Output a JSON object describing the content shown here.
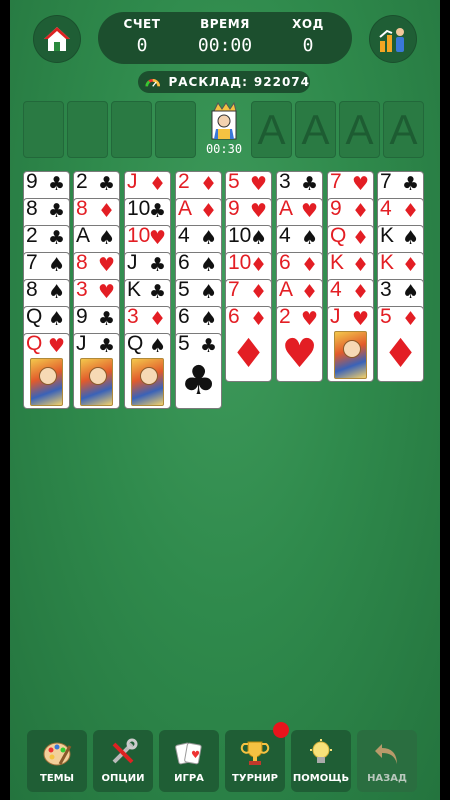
{
  "scoreboard": {
    "score_label": "СЧЕТ",
    "score_value": "0",
    "time_label": "ВРЕМЯ",
    "time_value": "00:00",
    "moves_label": "ХОД",
    "moves_value": "0"
  },
  "deal": {
    "label": "РАСКЛАД:",
    "number": "922074"
  },
  "top_row": {
    "free_cells": 4,
    "center_timer": "00:30",
    "foundations": [
      "A",
      "A",
      "A",
      "A"
    ]
  },
  "tableau": [
    [
      {
        "r": "9",
        "s": "♣",
        "c": "blk"
      },
      {
        "r": "8",
        "s": "♣",
        "c": "blk"
      },
      {
        "r": "2",
        "s": "♣",
        "c": "blk"
      },
      {
        "r": "7",
        "s": "♠",
        "c": "blk"
      },
      {
        "r": "8",
        "s": "♠",
        "c": "blk"
      },
      {
        "r": "Q",
        "s": "♠",
        "c": "blk"
      },
      {
        "r": "Q",
        "s": "♥",
        "c": "red",
        "face": true
      }
    ],
    [
      {
        "r": "2",
        "s": "♣",
        "c": "blk"
      },
      {
        "r": "8",
        "s": "♦",
        "c": "red"
      },
      {
        "r": "A",
        "s": "♠",
        "c": "blk"
      },
      {
        "r": "8",
        "s": "♥",
        "c": "red"
      },
      {
        "r": "3",
        "s": "♥",
        "c": "red"
      },
      {
        "r": "9",
        "s": "♣",
        "c": "blk"
      },
      {
        "r": "J",
        "s": "♣",
        "c": "blk",
        "face": true
      }
    ],
    [
      {
        "r": "J",
        "s": "♦",
        "c": "red"
      },
      {
        "r": "10",
        "s": "♣",
        "c": "blk"
      },
      {
        "r": "10",
        "s": "♥",
        "c": "red"
      },
      {
        "r": "J",
        "s": "♣",
        "c": "blk"
      },
      {
        "r": "K",
        "s": "♣",
        "c": "blk"
      },
      {
        "r": "3",
        "s": "♦",
        "c": "red"
      },
      {
        "r": "Q",
        "s": "♠",
        "c": "blk",
        "face": true
      }
    ],
    [
      {
        "r": "2",
        "s": "♦",
        "c": "red"
      },
      {
        "r": "A",
        "s": "♦",
        "c": "red"
      },
      {
        "r": "4",
        "s": "♠",
        "c": "blk"
      },
      {
        "r": "6",
        "s": "♠",
        "c": "blk"
      },
      {
        "r": "5",
        "s": "♠",
        "c": "blk"
      },
      {
        "r": "6",
        "s": "♠",
        "c": "blk"
      },
      {
        "r": "5",
        "s": "♣",
        "c": "blk",
        "big": true
      }
    ],
    [
      {
        "r": "5",
        "s": "♥",
        "c": "red"
      },
      {
        "r": "9",
        "s": "♥",
        "c": "red"
      },
      {
        "r": "10",
        "s": "♠",
        "c": "blk"
      },
      {
        "r": "10",
        "s": "♦",
        "c": "red"
      },
      {
        "r": "7",
        "s": "♦",
        "c": "red"
      },
      {
        "r": "6",
        "s": "♦",
        "c": "red",
        "big": true
      }
    ],
    [
      {
        "r": "3",
        "s": "♣",
        "c": "blk"
      },
      {
        "r": "A",
        "s": "♥",
        "c": "red"
      },
      {
        "r": "4",
        "s": "♠",
        "c": "blk"
      },
      {
        "r": "6",
        "s": "♦",
        "c": "red"
      },
      {
        "r": "A",
        "s": "♦",
        "c": "red"
      },
      {
        "r": "2",
        "s": "♥",
        "c": "red",
        "big": true
      }
    ],
    [
      {
        "r": "7",
        "s": "♥",
        "c": "red"
      },
      {
        "r": "9",
        "s": "♦",
        "c": "red"
      },
      {
        "r": "Q",
        "s": "♦",
        "c": "red"
      },
      {
        "r": "K",
        "s": "♦",
        "c": "red"
      },
      {
        "r": "4",
        "s": "♦",
        "c": "red"
      },
      {
        "r": "J",
        "s": "♥",
        "c": "red",
        "face": true
      }
    ],
    [
      {
        "r": "7",
        "s": "♣",
        "c": "blk"
      },
      {
        "r": "4",
        "s": "♦",
        "c": "red"
      },
      {
        "r": "K",
        "s": "♠",
        "c": "blk"
      },
      {
        "r": "K",
        "s": "♦",
        "c": "red"
      },
      {
        "r": "3",
        "s": "♠",
        "c": "blk"
      },
      {
        "r": "5",
        "s": "♦",
        "c": "red",
        "big": true
      }
    ]
  ],
  "toolbar": {
    "themes": "ТЕМЫ",
    "options": "ОПЦИИ",
    "game": "ИГРА",
    "tournament": "ТУРНИР",
    "help": "ПОМОЩЬ",
    "back": "НАЗАД"
  },
  "colors": {
    "felt": "#2f8a4c",
    "panel": "#1c4f2e",
    "red_suit": "#e31e24",
    "notification": "#e8141c"
  }
}
